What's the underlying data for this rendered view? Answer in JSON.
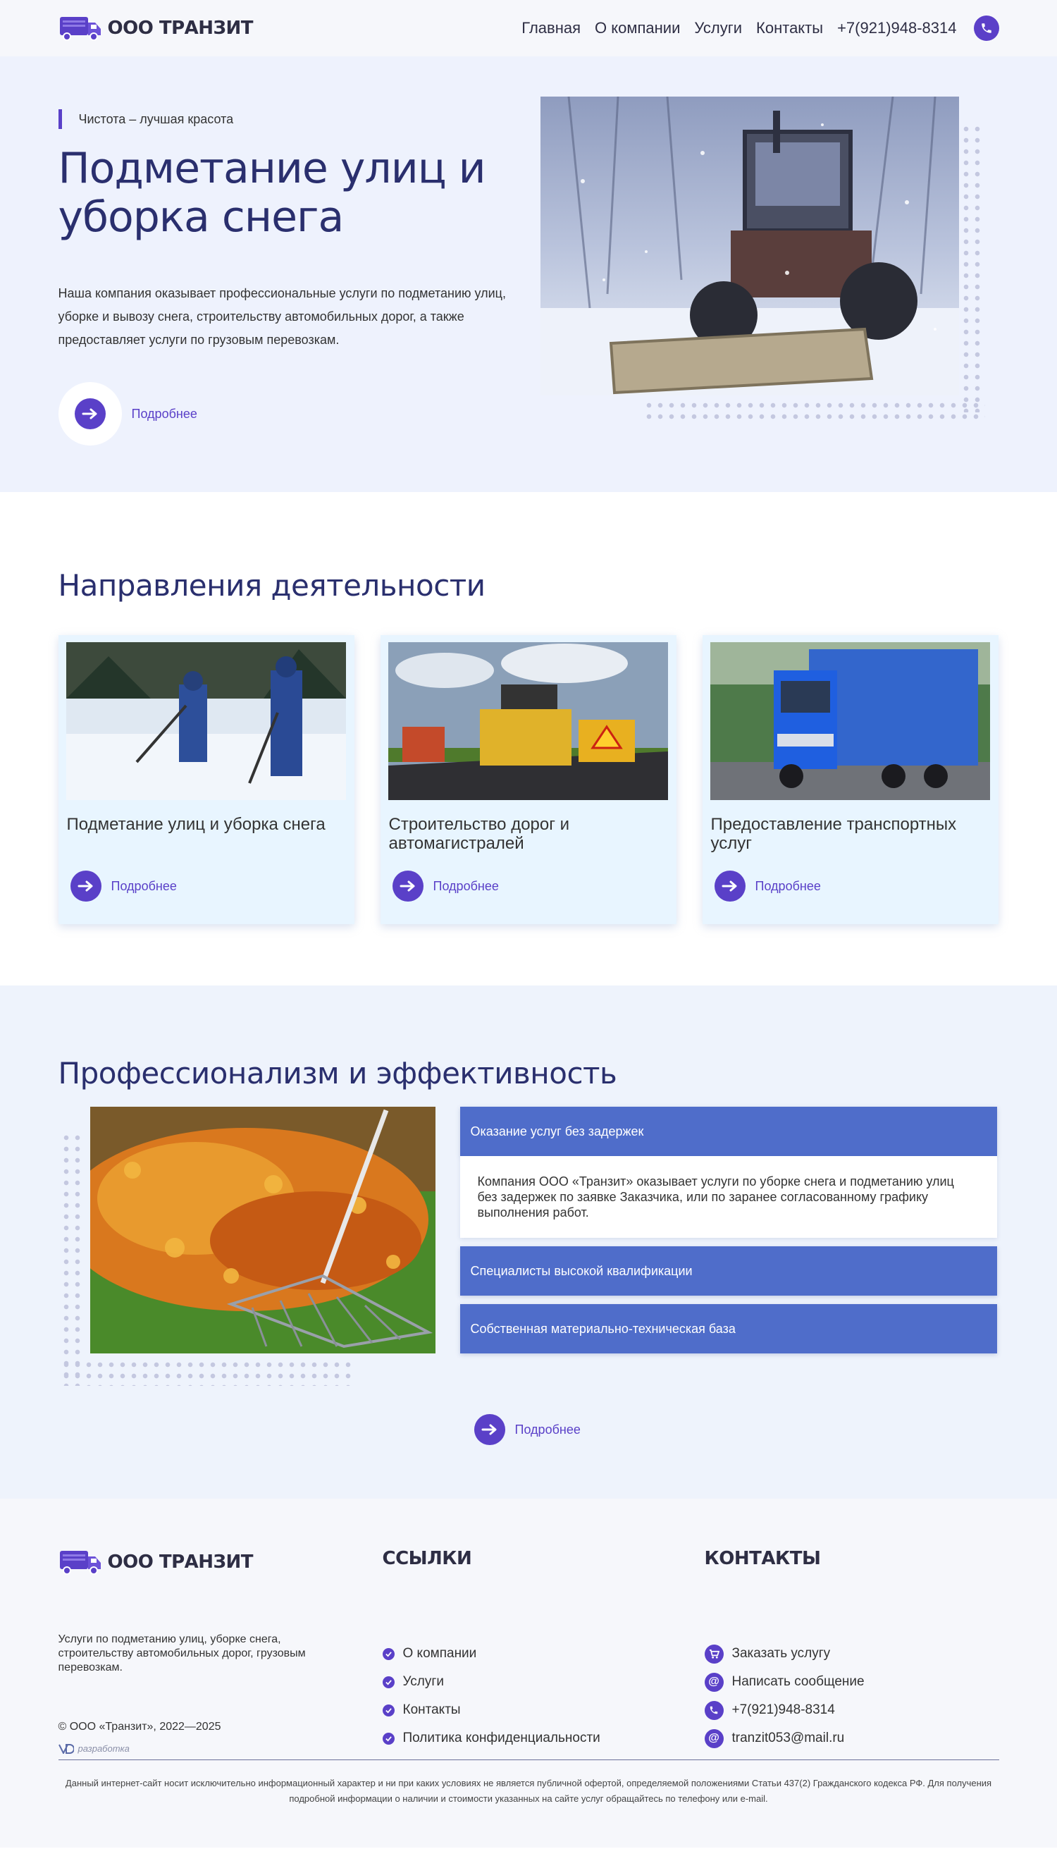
{
  "header": {
    "logo_text": "ООО ТРАНЗИТ",
    "nav": [
      "Главная",
      "О компании",
      "Услуги",
      "Контакты"
    ],
    "phone": "+7(921)948-8314"
  },
  "hero": {
    "tagline": "Чистота – лучшая красота",
    "title": "Подметание улиц и уборка снега",
    "description": "Наша компания оказывает профессиональные услуги по подметанию улиц, уборке и вывозу снега, строительству автомобильных дорог, а также предоставляет услуги по грузовым перевозкам.",
    "more_label": "Подробнее"
  },
  "directions": {
    "title": "Направления деятельности",
    "cards": [
      {
        "title": "Подметание улиц и уборка снега",
        "more_label": "Подробнее"
      },
      {
        "title": "Строительство дорог и автомагистралей",
        "more_label": "Подробнее"
      },
      {
        "title": "Предоставление транспортных услуг",
        "more_label": "Подробнее"
      }
    ]
  },
  "prof": {
    "title": "Профессионализм и эффективность",
    "accordion": [
      {
        "title": "Оказание услуг без задержек",
        "body": "Компания ООО «Транзит» оказывает услуги по уборке снега и подметанию улиц без задержек по заявке Заказчика, или по заранее согласованному графику выполнения работ."
      },
      {
        "title": "Специалисты высокой квалификации"
      },
      {
        "title": "Собственная материально-техническая база"
      }
    ],
    "more_label": "Подробнее"
  },
  "footer": {
    "logo_text": "ООО ТРАНЗИТ",
    "description": "Услуги по подметанию улиц, уборке снега, строительству автомобильных дорог, грузовым перевозкам.",
    "copyright": "© ООО «Транзит», 2022—2025",
    "dev_label": "разработка",
    "links_title": "ССЫЛКИ",
    "links": [
      "О компании",
      "Услуги",
      "Контакты",
      "Политика конфиденциальности"
    ],
    "contacts_title": "КОНТАКТЫ",
    "contacts": [
      "Заказать услугу",
      "Написать сообщение",
      "+7(921)948-8314",
      "tranzit053@mail.ru"
    ],
    "disclaimer": "Данный интернет-сайт носит исключительно информационный характер и ни при каких условиях не является публичной офертой, определяемой положениями Статьи 437(2) Гражданского кодекса РФ. Для получения подробной информации о наличии и стоимости указанных на сайте услуг обращайтесь по телефону или e-mail.",
    "accent_color": "#5a40c8"
  }
}
